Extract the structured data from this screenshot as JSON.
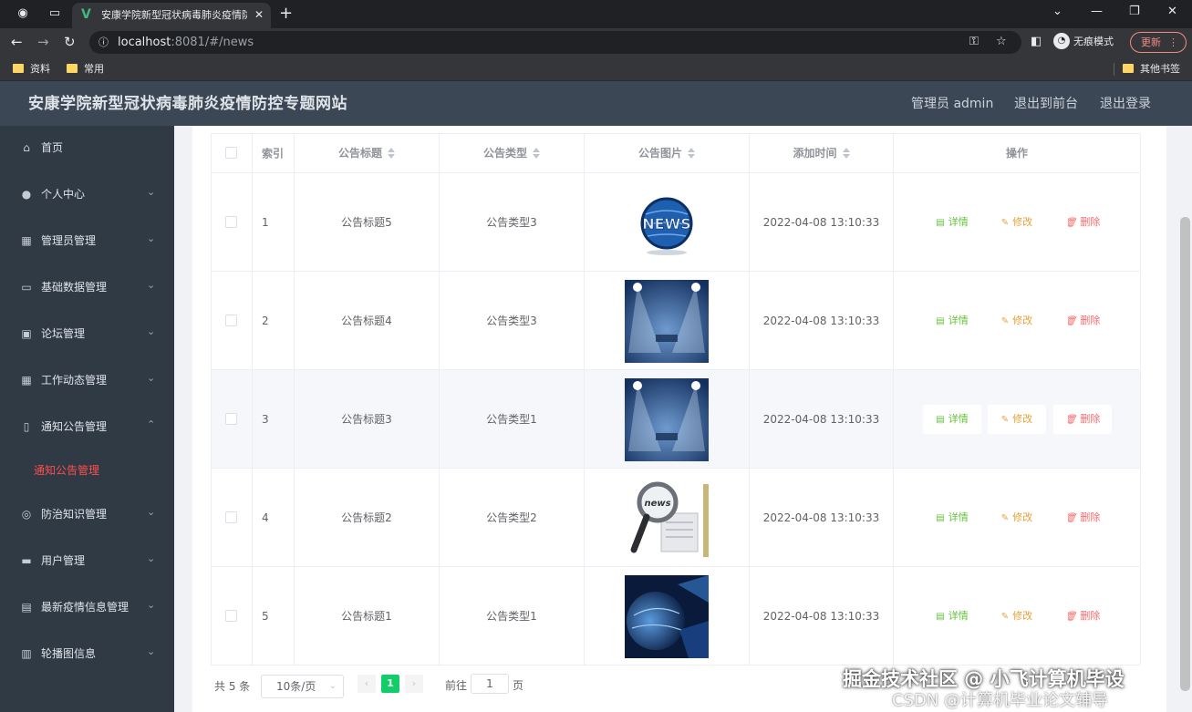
{
  "browser": {
    "tab_title": "安康学院新型冠状病毒肺炎疫情防控专题网站",
    "url_host": "localhost",
    "url_rest": ":8081/#/news",
    "incognito_label": "无痕模式",
    "update_label": "更新",
    "bookmarks": [
      "资料",
      "常用"
    ],
    "other_bookmarks": "其他书签"
  },
  "header": {
    "title": "安康学院新型冠状病毒肺炎疫情防控专题网站",
    "admin": "管理员 admin",
    "front": "退出到前台",
    "logout": "退出登录"
  },
  "sidebar": {
    "items": [
      {
        "label": "首页",
        "icon": "home-icon"
      },
      {
        "label": "个人中心",
        "icon": "user-icon"
      },
      {
        "label": "管理员管理",
        "icon": "grid-icon"
      },
      {
        "label": "基础数据管理",
        "icon": "chat-icon"
      },
      {
        "label": "论坛管理",
        "icon": "card-icon"
      },
      {
        "label": "工作动态管理",
        "icon": "apps-icon"
      },
      {
        "label": "通知公告管理",
        "icon": "phone-icon"
      },
      {
        "label": "防治知识管理",
        "icon": "compass-icon"
      },
      {
        "label": "用户管理",
        "icon": "briefcase-icon"
      },
      {
        "label": "最新疫情信息管理",
        "icon": "document-icon"
      },
      {
        "label": "轮播图信息",
        "icon": "chart-icon"
      }
    ],
    "active_sub": "通知公告管理"
  },
  "table": {
    "headers": {
      "index": "索引",
      "title": "公告标题",
      "type": "公告类型",
      "image": "公告图片",
      "time": "添加时间",
      "ops": "操作"
    },
    "rows": [
      {
        "index": "1",
        "title": "公告标题5",
        "type": "公告类型3",
        "time": "2022-04-08 13:10:33",
        "image": "news-globe"
      },
      {
        "index": "2",
        "title": "公告标题4",
        "type": "公告类型3",
        "time": "2022-04-08 13:10:33",
        "image": "stage-spotlight"
      },
      {
        "index": "3",
        "title": "公告标题3",
        "type": "公告类型1",
        "time": "2022-04-08 13:10:33",
        "image": "stage-spotlight"
      },
      {
        "index": "4",
        "title": "公告标题2",
        "type": "公告类型2",
        "time": "2022-04-08 13:10:33",
        "image": "magnifier-news"
      },
      {
        "index": "5",
        "title": "公告标题1",
        "type": "公告类型1",
        "time": "2022-04-08 13:10:33",
        "image": "blue-globe"
      }
    ],
    "actions": {
      "view": "详情",
      "edit": "修改",
      "delete": "删除"
    }
  },
  "pagination": {
    "total": "共 5 条",
    "page_size": "10条/页",
    "current_page": "1",
    "goto": "前往",
    "goto_value": "1",
    "page_suffix": "页"
  },
  "watermark": {
    "line1": "掘金技术社区 @ 小飞计算机毕设",
    "line2": "CSDN @计算机毕业论文辅导"
  },
  "colors": {
    "header_bg": "#3c4755",
    "sidebar_bg": "#303a45",
    "active_sub": "#ff4d4f",
    "view": "#67c23a",
    "edit": "#e6a23c",
    "delete": "#f56c6c",
    "page_active": "#13ce66"
  }
}
